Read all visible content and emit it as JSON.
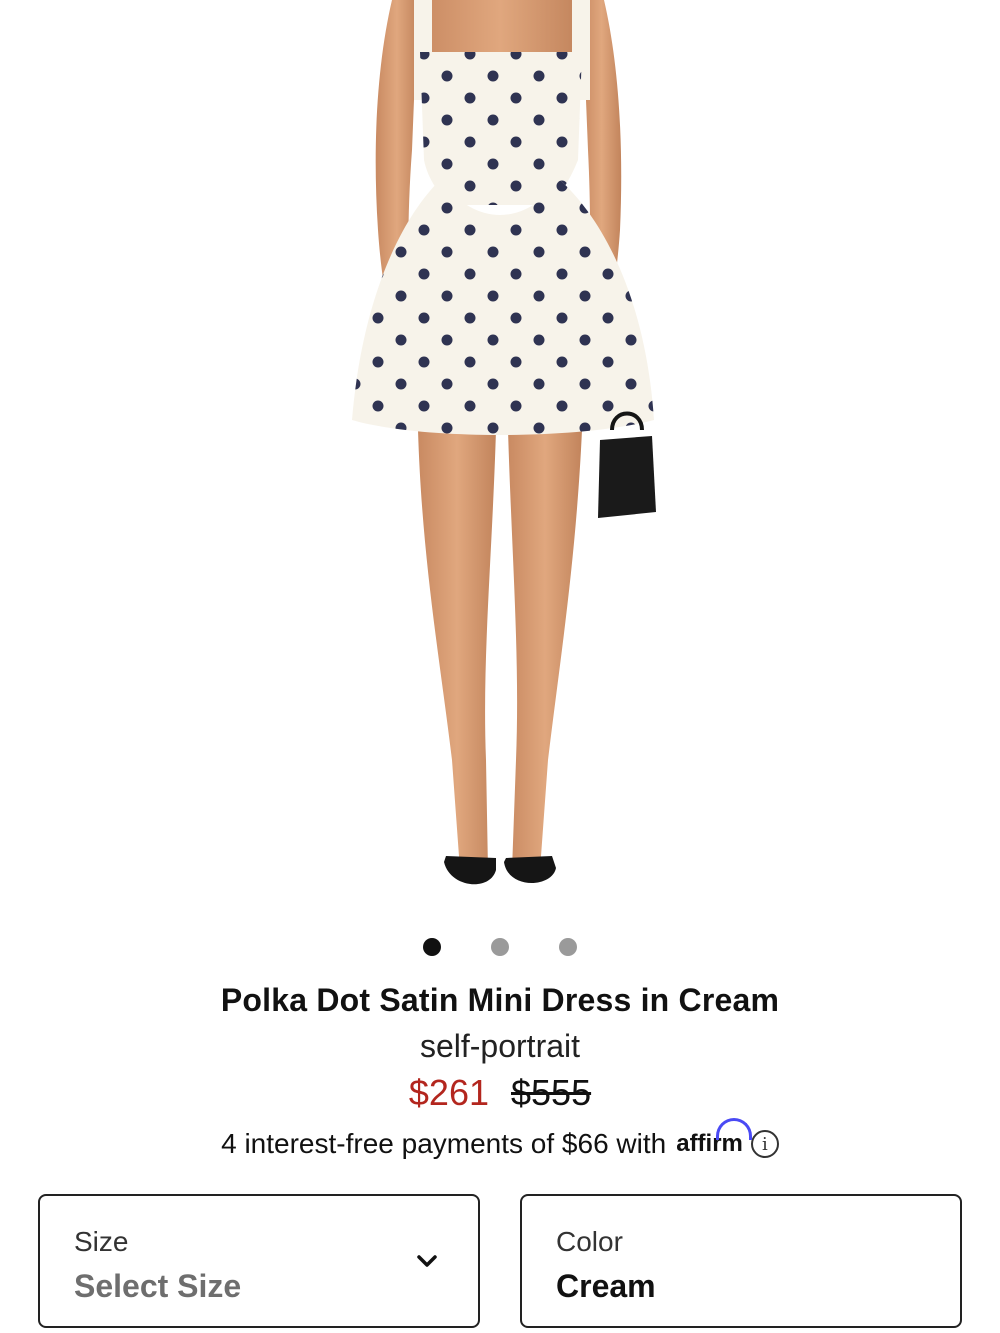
{
  "product": {
    "image_alt": "model wearing polka dot satin mini dress",
    "title": "Polka Dot Satin Mini Dress in Cream",
    "brand": "self-portrait",
    "price_sale": "$261",
    "price_original": "$555"
  },
  "carousel": {
    "active_index": 0
  },
  "financing": {
    "text": "4 interest-free payments of $66 with",
    "provider": "affirm",
    "info_icon": "info-icon"
  },
  "options": {
    "size": {
      "label": "Size",
      "value": "Select Size"
    },
    "color": {
      "label": "Color",
      "value": "Cream"
    }
  },
  "colors": {
    "sale_price": "#b3261e",
    "affirm_blue": "#4a4af4",
    "dress_cream": "#f7f3ea",
    "dot_navy": "#2f3352"
  }
}
